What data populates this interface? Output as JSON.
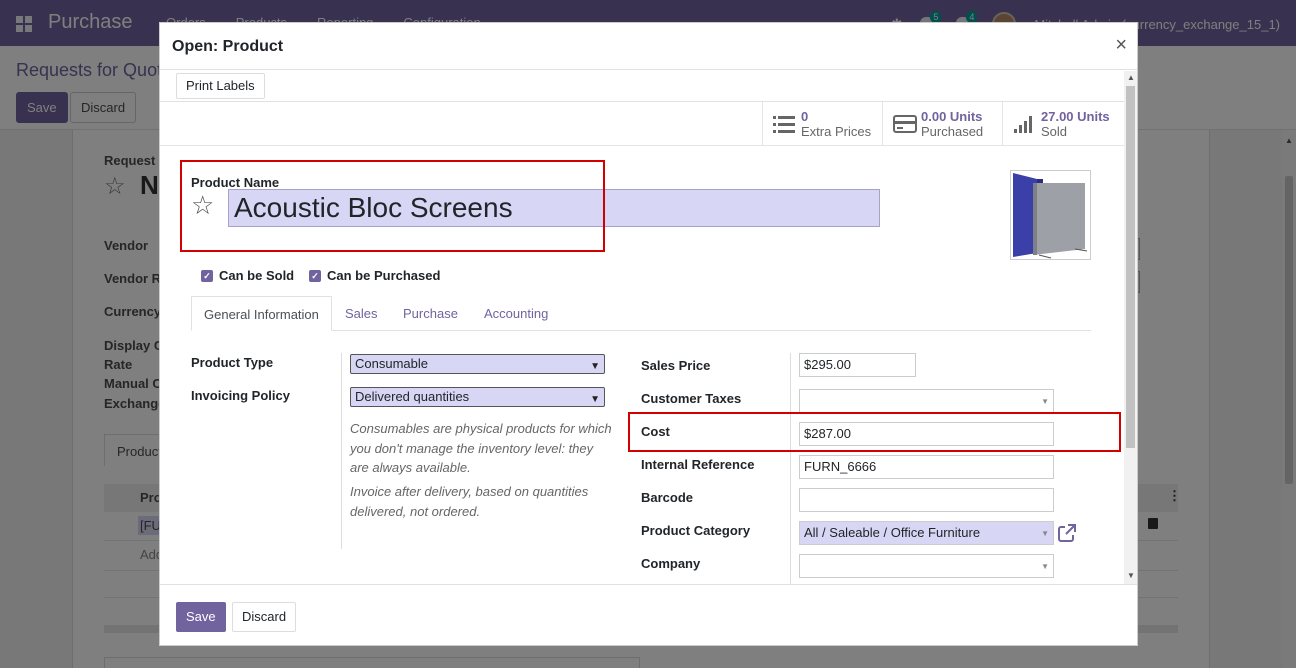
{
  "background": {
    "navbar": {
      "brand": "Purchase",
      "menu": [
        "Orders",
        "Products",
        "Reporting",
        "Configuration"
      ],
      "activity_count": "5",
      "message_count": "4",
      "user": "Mitchell Admin (currency_exchange_15_1)"
    },
    "breadcrumb": "Requests for Quotation",
    "save_label": "Save",
    "discard_label": "Discard",
    "form": {
      "request_label": "Request",
      "title": "N",
      "vendor_label": "Vendor",
      "vendor_ref_label": "Vendor R",
      "currency_label": "Currency",
      "display_label": "Display C",
      "rate_label": "Rate",
      "manual_label": "Manual C",
      "exchange_label": "Exchange",
      "tab_products": "Product",
      "col_product": "Pro",
      "row_product": "[FU",
      "add_line": "Add"
    }
  },
  "modal": {
    "title": "Open: Product",
    "close_glyph": "×",
    "print_labels": "Print Labels",
    "smart_buttons": [
      {
        "icon": "list-icon",
        "value": "0",
        "label": "Extra Prices"
      },
      {
        "icon": "credit-card-icon",
        "value": "0.00 Units",
        "label": "Purchased"
      },
      {
        "icon": "signal-bars-icon",
        "value": "27.00 Units",
        "label": "Sold"
      }
    ],
    "product_name_label": "Product Name",
    "product_name": "Acoustic Bloc Screens",
    "can_be_sold": "Can be Sold",
    "can_be_purchased": "Can be Purchased",
    "tabs": [
      "General Information",
      "Sales",
      "Purchase",
      "Accounting"
    ],
    "left": {
      "product_type_label": "Product Type",
      "product_type": "Consumable",
      "invoicing_policy_label": "Invoicing Policy",
      "invoicing_policy": "Delivered quantities",
      "help_type": "Consumables are physical products for which you don't manage the inventory level: they are always available.",
      "help_policy": "Invoice after delivery, based on quantities delivered, not ordered."
    },
    "right": {
      "sales_price_label": "Sales Price",
      "sales_price": "$295.00",
      "customer_taxes_label": "Customer Taxes",
      "customer_taxes": "",
      "cost_label": "Cost",
      "cost": "$287.00",
      "internal_ref_label": "Internal Reference",
      "internal_ref": "FURN_6666",
      "barcode_label": "Barcode",
      "barcode": "",
      "category_label": "Product Category",
      "category": "All / Saleable / Office Furniture",
      "company_label": "Company",
      "company": ""
    },
    "footer": {
      "save": "Save",
      "discard": "Discard"
    }
  },
  "colors": {
    "brand": "#71639e",
    "highlight": "#d30000",
    "field_highlight": "#d8d6f5"
  }
}
